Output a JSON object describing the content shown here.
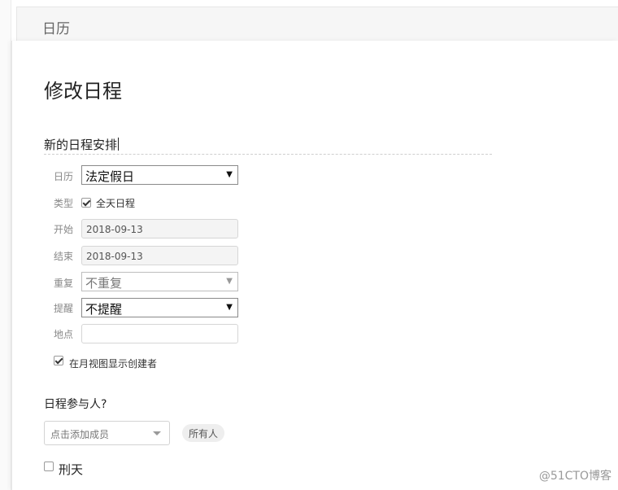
{
  "header": {
    "title": "日历"
  },
  "dialog": {
    "title": "修改日程",
    "event_title_value": "新的日程安排"
  },
  "form": {
    "calendar": {
      "label": "日历",
      "value": "法定假日"
    },
    "type": {
      "label": "类型",
      "allday_label": "全天日程",
      "allday_checked": true
    },
    "start": {
      "label": "开始",
      "value": "2018-09-13"
    },
    "end": {
      "label": "结束",
      "value": "2018-09-13"
    },
    "repeat": {
      "label": "重复",
      "value": "不重复"
    },
    "remind": {
      "label": "提醒",
      "value": "不提醒"
    },
    "location": {
      "label": "地点",
      "value": ""
    },
    "show_creator": {
      "label": "在月视图显示创建者",
      "checked": true
    }
  },
  "participants": {
    "title": "日程参与人?",
    "add_placeholder": "点击添加成员",
    "tag_all": "所有人",
    "members": [
      {
        "name": "刑天",
        "checked": false
      }
    ]
  },
  "watermark": "@51CTO博客"
}
